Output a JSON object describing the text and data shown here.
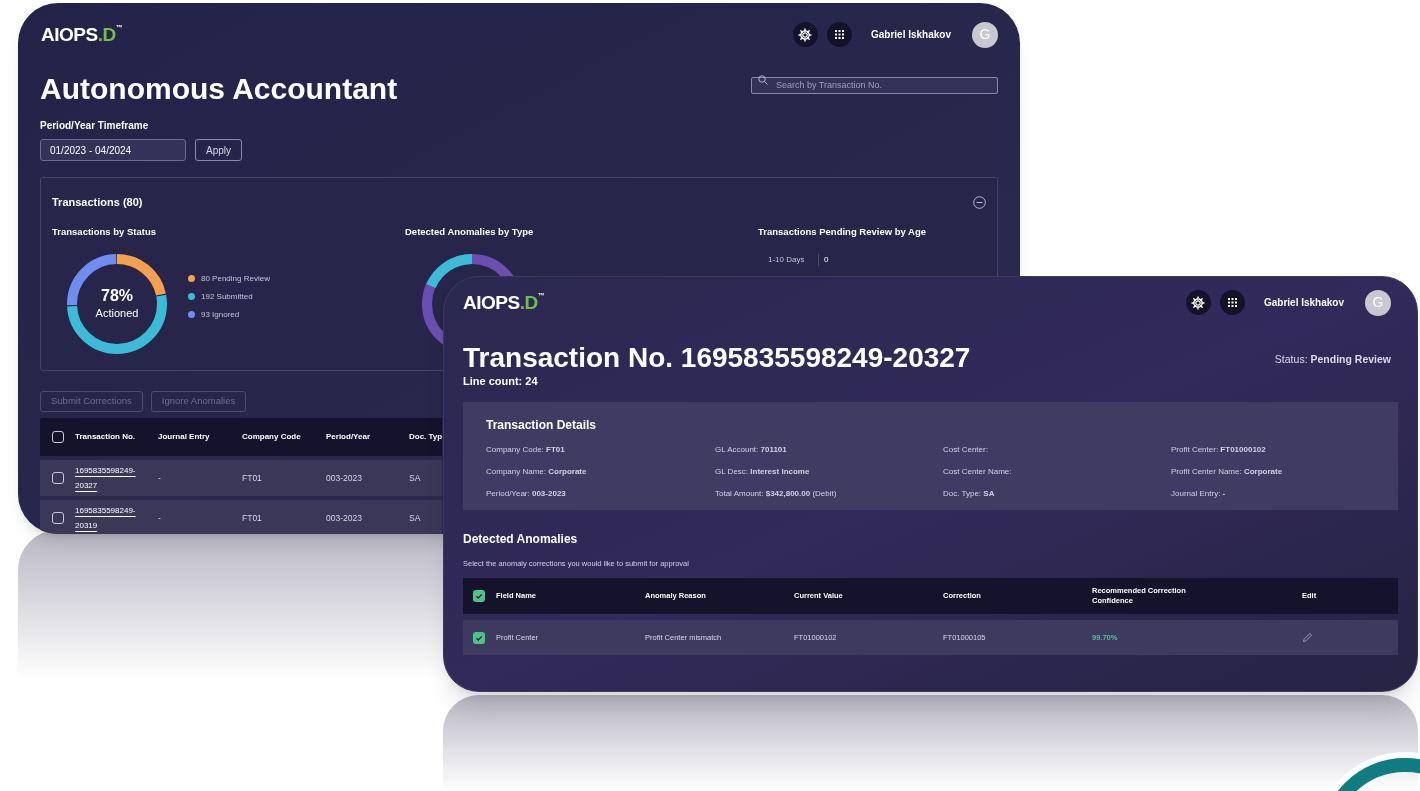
{
  "back_window": {
    "logo": {
      "text": "AIOPS",
      "accent": ".D",
      "mark": "™"
    },
    "header": {
      "user_name": "Gabriel Iskhakov",
      "avatar_initial": "G"
    },
    "title": "Autonomous Accountant",
    "search": {
      "placeholder": "Search by Transaction No."
    },
    "timeframe": {
      "label": "Period/Year Timeframe",
      "value": "01/2023 - 04/2024",
      "button": "Apply"
    },
    "summary": {
      "title": "Transactions (80)",
      "expanded": true,
      "status_panel": {
        "title": "Transactions by Status",
        "center_value": "78%",
        "center_label": "Actioned",
        "legend": [
          {
            "label": "80 Pending Review",
            "color": "#f4a14e"
          },
          {
            "label": "192 Submitted",
            "color": "#3bbcd6"
          },
          {
            "label": "93 Ignored",
            "color": "#6f8df0"
          }
        ]
      },
      "anomalies_panel": {
        "title": "Detected Anomalies by Type"
      },
      "age_panel": {
        "title": "Transactions Pending Review by Age",
        "rows": [
          {
            "label": "1-10 Days",
            "count": "0"
          }
        ]
      }
    },
    "actions": [
      {
        "label": "Submit Corrections",
        "disabled": true
      },
      {
        "label": "Ignore Anomalies",
        "disabled": true
      }
    ],
    "table": {
      "all_checked": false,
      "columns": [
        "Transaction No.",
        "Journal Entry",
        "Company Code",
        "Period/Year",
        "Doc. Typ"
      ],
      "rows": [
        {
          "checked": false,
          "cells": [
            "1695835598249-20327",
            "-",
            "FT01",
            "003-2023",
            "SA"
          ]
        },
        {
          "checked": false,
          "cells": [
            "1695835598249-20319",
            "-",
            "FT01",
            "003-2023",
            "SA"
          ]
        }
      ]
    }
  },
  "front_window": {
    "logo": {
      "text": "AIOPS",
      "accent": ".D",
      "mark": "™"
    },
    "header": {
      "user_name": "Gabriel Iskhakov",
      "avatar_initial": "G"
    },
    "title": "Transaction No. 1695835598249-20327",
    "line_count": "Line count: 24",
    "status": "Status: **Pending Review**",
    "details": {
      "title": "Transaction Details",
      "fields": [
        "Company Code: **FT01**",
        "GL Account: **701101**",
        "Cost Center:",
        "Profit Center: **FT01000102**",
        "Company Name: **Corporate**",
        "GL Desc: **Interest Income**",
        "Cost Center Name:",
        "Profit Center Name: **Corporate**",
        "Period/Year: **003-2023**",
        "Total Amount: **$342,800.00** (Debit)",
        "Doc. Type: **SA**",
        "Journal Entry: **-**"
      ]
    },
    "anomalies": {
      "title": "Detected Anomalies",
      "subtitle": "Select the anomaly corrections you would like to submit for approval",
      "all_checked": true,
      "columns": [
        "Field Name",
        "Anomaly Reason",
        "Current Value",
        "Correction",
        "Recommended Correction Confidence",
        "Edit"
      ],
      "rows": [
        {
          "checked": true,
          "cells": [
            "Profit Center",
            "Profit Center mismatch",
            "FT01000102",
            "FT01000105",
            "99.70%"
          ]
        }
      ]
    }
  }
}
